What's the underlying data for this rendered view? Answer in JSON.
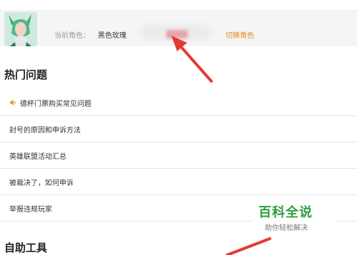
{
  "role_bar": {
    "label": "当前角色：",
    "role_name": "黑色玫瑰",
    "switch_label": "切换角色"
  },
  "hot_questions": {
    "title": "热门问题",
    "items": [
      {
        "label": "德杯门票购买常见问题",
        "icon": "speaker-icon"
      },
      {
        "label": "封号的原因和申诉方法"
      },
      {
        "label": "英雄联盟活动汇总"
      },
      {
        "label": "被裁决了，如何申诉"
      },
      {
        "label": "举报违规玩家"
      }
    ]
  },
  "self_service": {
    "title": "自助工具"
  },
  "watermark": {
    "title": "百科全说",
    "subtitle": "助你轻松解决"
  },
  "colors": {
    "accent": "#e38b1b",
    "arrow": "#e53935",
    "watermark": "#2e9e3f"
  }
}
